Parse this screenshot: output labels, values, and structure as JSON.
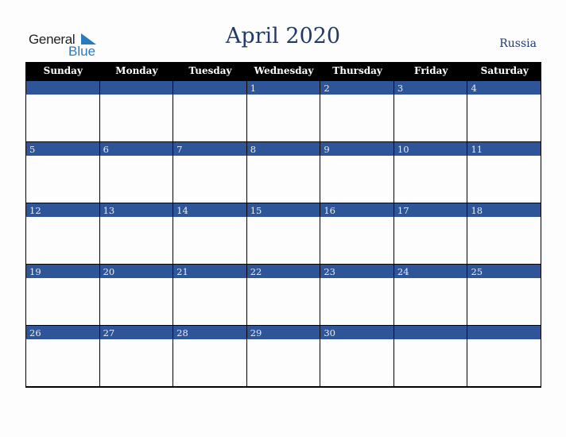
{
  "logo": {
    "line1": "General",
    "line2": "Blue"
  },
  "title": "April 2020",
  "country": "Russia",
  "weekdays": [
    "Sunday",
    "Monday",
    "Tuesday",
    "Wednesday",
    "Thursday",
    "Friday",
    "Saturday"
  ],
  "weeks": [
    [
      "",
      "",
      "",
      "1",
      "2",
      "3",
      "4"
    ],
    [
      "5",
      "6",
      "7",
      "8",
      "9",
      "10",
      "11"
    ],
    [
      "12",
      "13",
      "14",
      "15",
      "16",
      "17",
      "18"
    ],
    [
      "19",
      "20",
      "21",
      "22",
      "23",
      "24",
      "25"
    ],
    [
      "26",
      "27",
      "28",
      "29",
      "30",
      "",
      ""
    ]
  ],
  "colors": {
    "header": "#000000",
    "date_bar": "#2e5597",
    "title": "#223a66",
    "brand_blue": "#2a7ac0"
  }
}
